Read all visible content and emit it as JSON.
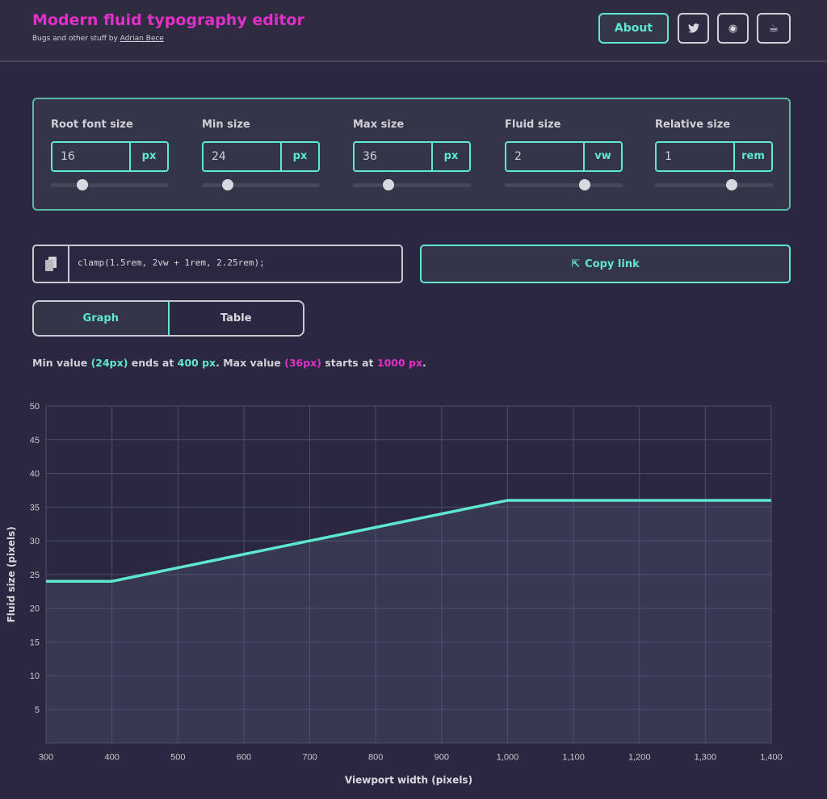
{
  "header": {
    "title": "Modern fluid typography editor",
    "subtitle_prefix": "Bugs and other stuff by ",
    "author": "Adrian Bece",
    "about_label": "About",
    "icons": [
      "twitter-icon",
      "github-icon",
      "coffee-icon"
    ]
  },
  "controls": [
    {
      "label": "Root font size",
      "value": "16",
      "unit": "px",
      "slider_percent": 27
    },
    {
      "label": "Min size",
      "value": "24",
      "unit": "px",
      "slider_percent": 22
    },
    {
      "label": "Max size",
      "value": "36",
      "unit": "px",
      "slider_percent": 30
    },
    {
      "label": "Fluid size",
      "value": "2",
      "unit": "vw",
      "slider_percent": 68
    },
    {
      "label": "Relative size",
      "value": "1",
      "unit": "rem",
      "slider_percent": 65
    }
  ],
  "output": {
    "code": "clamp(1.5rem, 2vw + 1rem, 2.25rem);",
    "copy_label": "Copy link"
  },
  "tabs": [
    {
      "label": "Graph",
      "active": true
    },
    {
      "label": "Table",
      "active": false
    }
  ],
  "info": {
    "p1": "Min value ",
    "min": "(24px)",
    "p2": " ends at ",
    "min_at": "400 px",
    "p3": ". Max value ",
    "max": "(36px)",
    "p4": " starts at ",
    "max_at": "1000 px",
    "p5": "."
  },
  "colors": {
    "accent": "#5ee8d0",
    "brand": "#e030c8",
    "background": "#2c2740"
  },
  "chart_data": {
    "type": "line",
    "xlabel": "Viewport width (pixels)",
    "ylabel": "Fluid size (pixels)",
    "xlim": [
      300,
      1400
    ],
    "ylim": [
      0,
      50
    ],
    "grid": true,
    "x_ticks": [
      "300",
      "400",
      "500",
      "600",
      "700",
      "800",
      "900",
      "1,000",
      "1,100",
      "1,200",
      "1,300",
      "1,400"
    ],
    "y_ticks": [
      "5",
      "10",
      "15",
      "20",
      "25",
      "30",
      "35",
      "40",
      "45",
      "50"
    ],
    "series": [
      {
        "x": [
          300,
          400,
          1000,
          1400
        ],
        "y": [
          24,
          24,
          36,
          36
        ]
      }
    ]
  }
}
